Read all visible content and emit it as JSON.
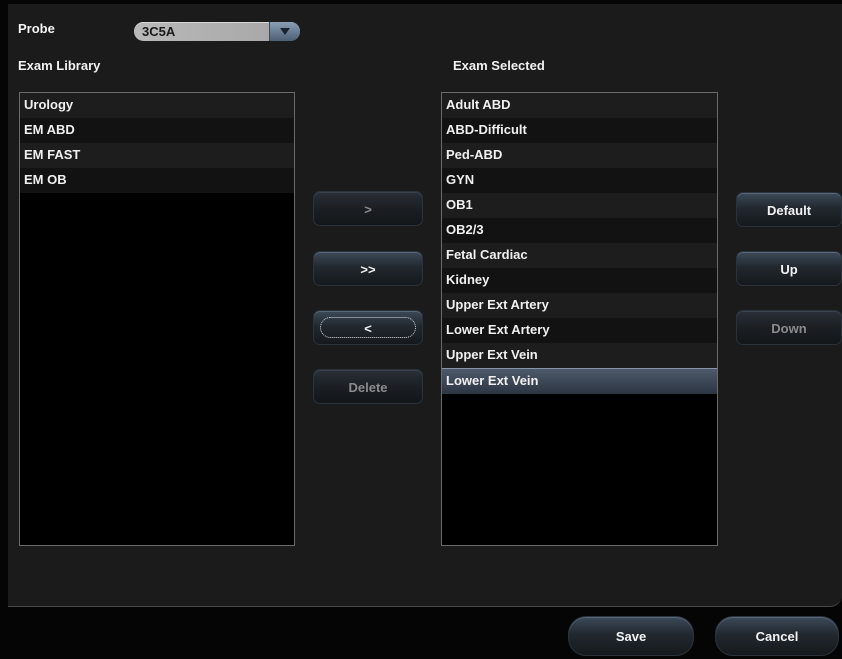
{
  "probe": {
    "label": "Probe",
    "value": "3C5A",
    "arrow_icon": "chevron-down-icon"
  },
  "library": {
    "title": "Exam Library",
    "items": [
      "Urology",
      "EM ABD",
      "EM FAST",
      "EM OB"
    ]
  },
  "selected": {
    "title": "Exam Selected",
    "items": [
      "Adult ABD",
      "ABD-Difficult",
      "Ped-ABD",
      "GYN",
      "OB1",
      "OB2/3",
      "Fetal Cardiac",
      "Kidney",
      "Upper Ext Artery",
      "Lower Ext Artery",
      "Upper Ext Vein",
      "Lower Ext Vein"
    ],
    "highlighted": "Lower Ext Vein"
  },
  "transfer": {
    "add_label": ">",
    "add_all_label": ">>",
    "remove_label": "<",
    "delete_label": "Delete"
  },
  "order": {
    "default_label": "Default",
    "up_label": "Up",
    "down_label": "Down"
  },
  "footer": {
    "save_label": "Save",
    "cancel_label": "Cancel"
  },
  "colors": {
    "background": "#1b1b1b",
    "list_background": "#000000",
    "selection": "#3a4656",
    "button_top": "#3c4a58"
  }
}
